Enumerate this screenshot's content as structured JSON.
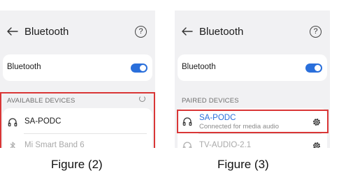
{
  "left_screen": {
    "header": {
      "title": "Bluetooth",
      "help_glyph": "?"
    },
    "toggle": {
      "label": "Bluetooth",
      "state": "on"
    },
    "section_label": "AVAILABLE DEVICES",
    "devices": [
      {
        "name": "SA-PODC",
        "icon": "headphones-icon",
        "dimmed": false
      },
      {
        "name": "Mi Smart Band 6",
        "icon": "bluetooth-icon",
        "dimmed": true
      }
    ]
  },
  "right_screen": {
    "header": {
      "title": "Bluetooth",
      "help_glyph": "?"
    },
    "toggle": {
      "label": "Bluetooth",
      "state": "on"
    },
    "section_label": "PAIRED DEVICES",
    "devices": [
      {
        "name": "SA-PODC",
        "status": "Connected for media audio",
        "icon": "headphones-icon",
        "dimmed": false
      },
      {
        "name": "TV-AUDIO-2.1",
        "icon": "headphones-icon",
        "dimmed": true
      }
    ]
  },
  "captions": {
    "left": "Figure (2)",
    "right": "Figure (3)"
  },
  "colors": {
    "accent": "#2a6fdb",
    "highlight": "#d93636",
    "background": "#f1f1f3"
  }
}
